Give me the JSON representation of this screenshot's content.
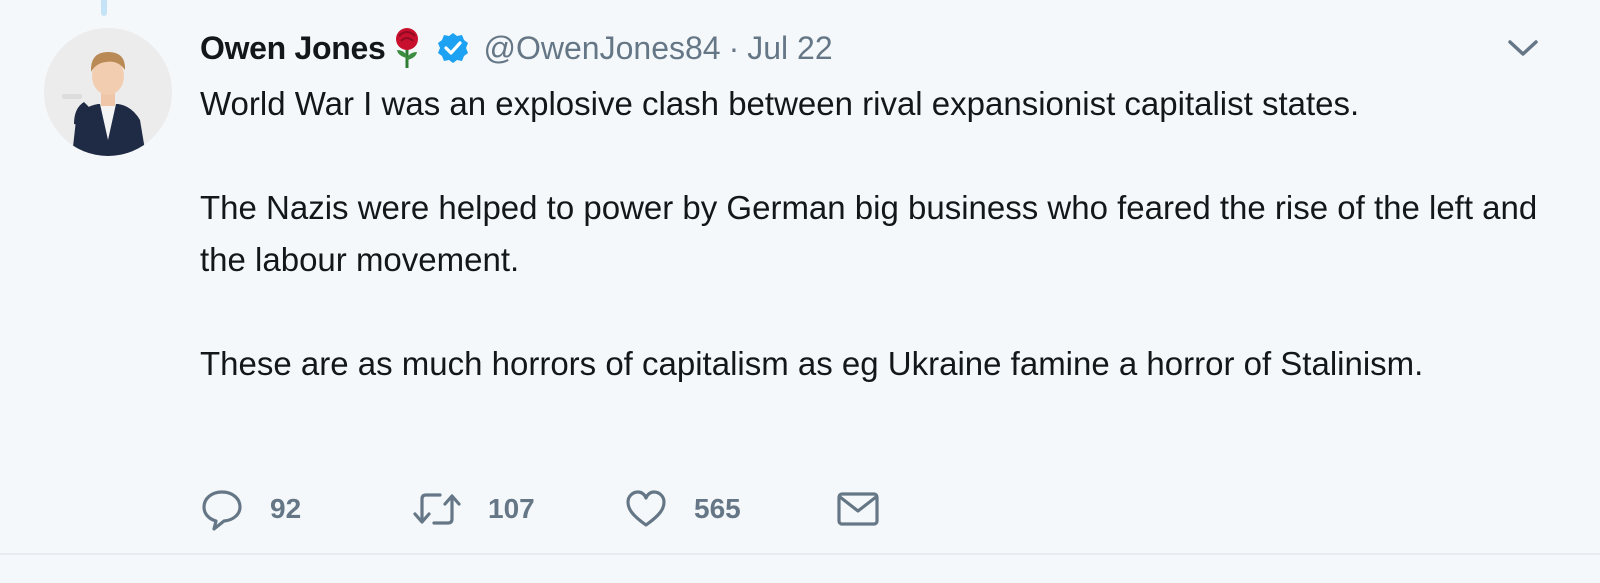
{
  "tweet": {
    "author_name": "Owen Jones",
    "handle": "@OwenJones84",
    "separator": "·",
    "date": "Jul 22",
    "paragraphs": [
      "World War I was an explosive clash between rival expansionist capitalist states.",
      "The Nazis were helped to power by German big business who feared the rise of the left and the labour movement.",
      "These are as much horrors of capitalism as eg Ukraine famine a horror of Stalinism."
    ],
    "replies": "92",
    "retweets": "107",
    "likes": "565"
  },
  "icons": {
    "author_emoji": "rose-icon",
    "verified": "verified-badge-icon",
    "menu": "chevron-down-icon",
    "reply": "reply-icon",
    "retweet": "retweet-icon",
    "like": "heart-icon",
    "dm": "envelope-icon"
  },
  "colors": {
    "background": "#f5f8fa",
    "text": "#14171a",
    "muted": "#657786",
    "verified": "#1da1f2",
    "rose": "#c8102e"
  }
}
